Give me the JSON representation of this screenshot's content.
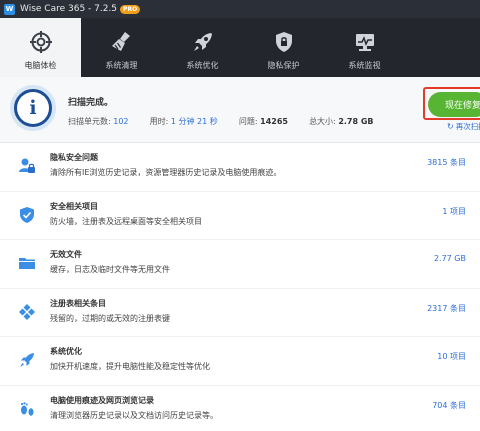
{
  "window": {
    "app_logo": "W",
    "title": "Wise Care 365 - 7.2.5",
    "edition": "PRO"
  },
  "nav": [
    {
      "label": "电脑体检",
      "icon": "crosshair-icon",
      "active": true
    },
    {
      "label": "系统清理",
      "icon": "broom-icon",
      "active": false
    },
    {
      "label": "系统优化",
      "icon": "rocket-icon",
      "active": false
    },
    {
      "label": "隐私保护",
      "icon": "shield-lock-icon",
      "active": false
    },
    {
      "label": "系统监视",
      "icon": "monitor-icon",
      "active": false
    }
  ],
  "summary": {
    "icon": "info-icon",
    "title": "扫描完成。",
    "units_label": "扫描单元数:",
    "units_value": "102",
    "time_label": "用时:",
    "time_value": "1 分钟 21 秒",
    "issues_label": "问题:",
    "issues_value": "14265",
    "size_label": "总大小:",
    "size_value": "2.78 GB",
    "fix_button": "现在修复",
    "rescan": "再次扫描"
  },
  "colors": {
    "accent_blue": "#2b6fd6",
    "fix_green": "#58b533",
    "highlight_red": "#e33a2a",
    "nav_bg": "#23262d"
  },
  "items": [
    {
      "icon": "privacy-user-icon",
      "title": "隐私安全问题",
      "desc": "清除所有IE浏览历史记录，资源管理器历史记录及电脑使用痕迹。",
      "value": "3815 条目"
    },
    {
      "icon": "security-shield-icon",
      "title": "安全相关项目",
      "desc": "防火墙，注册表及远程桌面等安全相关项目",
      "value": "1 项目"
    },
    {
      "icon": "folder-icon",
      "title": "无效文件",
      "desc": "缓存，日志及临时文件等无用文件",
      "value": "2.77 GB"
    },
    {
      "icon": "registry-cubes-icon",
      "title": "注册表相关条目",
      "desc": "残留的，过期的或无效的注册表键",
      "value": "2317 条目"
    },
    {
      "icon": "optimize-rocket-icon",
      "title": "系统优化",
      "desc": "加快开机速度，提升电脑性能及稳定性等优化",
      "value": "10 项目"
    },
    {
      "icon": "footprint-icon",
      "title": "电脑使用痕迹及网页浏览记录",
      "desc": "清理浏览器历史记录以及文档访问历史记录等。",
      "value": "704 条目"
    }
  ]
}
